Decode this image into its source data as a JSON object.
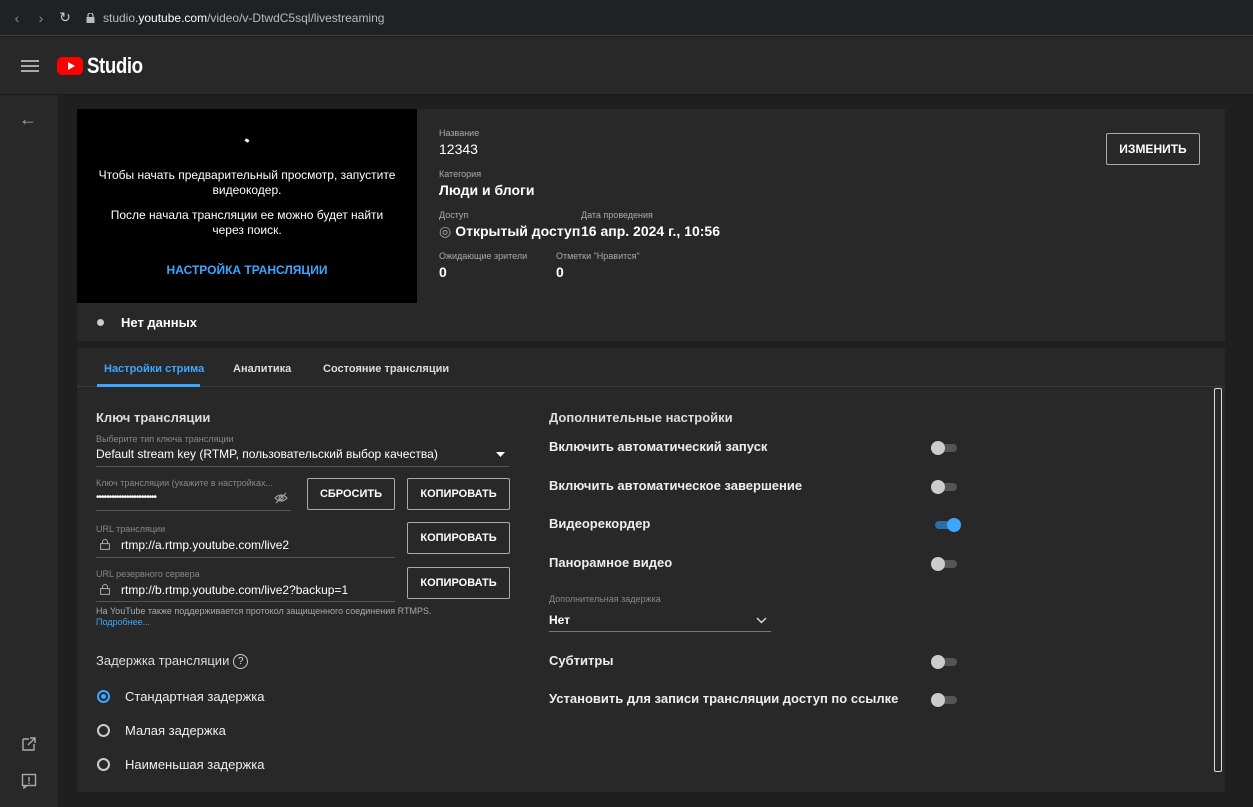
{
  "browser": {
    "url_prefix": "studio.",
    "url_domain": "youtube.com",
    "url_path": "/video/v-DtwdC5sql/livestreaming"
  },
  "header": {
    "logo_text": "Studio"
  },
  "preview": {
    "message1": "Чтобы начать предварительный просмотр, запустите видеокодер.",
    "message2": "После начала трансляции ее можно будет найти через поиск.",
    "setup_link": "НАСТРОЙКА ТРАНСЛЯЦИИ"
  },
  "meta": {
    "title_label": "Название",
    "title_value": "12343",
    "category_label": "Категория",
    "category_value": "Люди и блоги",
    "access_label": "Доступ",
    "access_value": "Открытый доступ",
    "date_label": "Дата проведения",
    "date_value": "16 апр. 2024 г., 10:56",
    "waiting_label": "Ожидающие зрители",
    "waiting_value": "0",
    "likes_label": "Отметки \"Нравится\"",
    "likes_value": "0",
    "edit_button": "ИЗМЕНИТЬ",
    "status": "Нет данных"
  },
  "tabs": [
    {
      "label": "Настройки стрима",
      "active": true
    },
    {
      "label": "Аналитика",
      "active": false
    },
    {
      "label": "Состояние трансляции",
      "active": false
    }
  ],
  "stream_key": {
    "section_title": "Ключ трансляции",
    "type_label": "Выберите тип ключа трансляции",
    "type_value": "Default stream key (RTMP, пользовательский выбор качества)",
    "key_label": "Ключ трансляции (укажите в настройках...",
    "key_value": "••••••••••••••••••••••••",
    "reset_button": "СБРОСИТЬ",
    "copy_button": "КОПИРОВАТЬ",
    "url_label": "URL трансляции",
    "url_value": "rtmp://a.rtmp.youtube.com/live2",
    "backup_label": "URL резервного сервера",
    "backup_value": "rtmp://b.rtmp.youtube.com/live2?backup=1",
    "rtmps_note": "На YouTube также поддерживается протокол защищенного соединения RTMPS.",
    "more_link": "Подробнее..."
  },
  "latency": {
    "section_title": "Задержка трансляции",
    "help": "?",
    "options": [
      {
        "label": "Стандартная задержка",
        "selected": true
      },
      {
        "label": "Малая задержка",
        "selected": false
      },
      {
        "label": "Наименьшая задержка",
        "selected": false
      }
    ]
  },
  "extra": {
    "section_title": "Дополнительные настройки",
    "settings": [
      {
        "label": "Включить автоматический запуск",
        "on": false
      },
      {
        "label": "Включить автоматическое завершение",
        "on": false
      },
      {
        "label": "Видеорекордер",
        "on": true
      },
      {
        "label": "Панорамное видео",
        "on": false
      }
    ],
    "delay_label": "Дополнительная задержка",
    "delay_value": "Нет",
    "settings2": [
      {
        "label": "Субтитры",
        "on": false
      },
      {
        "label": "Установить для записи трансляции доступ по ссылке",
        "on": false
      }
    ]
  },
  "colors": {
    "accent": "#3ea6ff",
    "brand_red": "#ff0000"
  }
}
